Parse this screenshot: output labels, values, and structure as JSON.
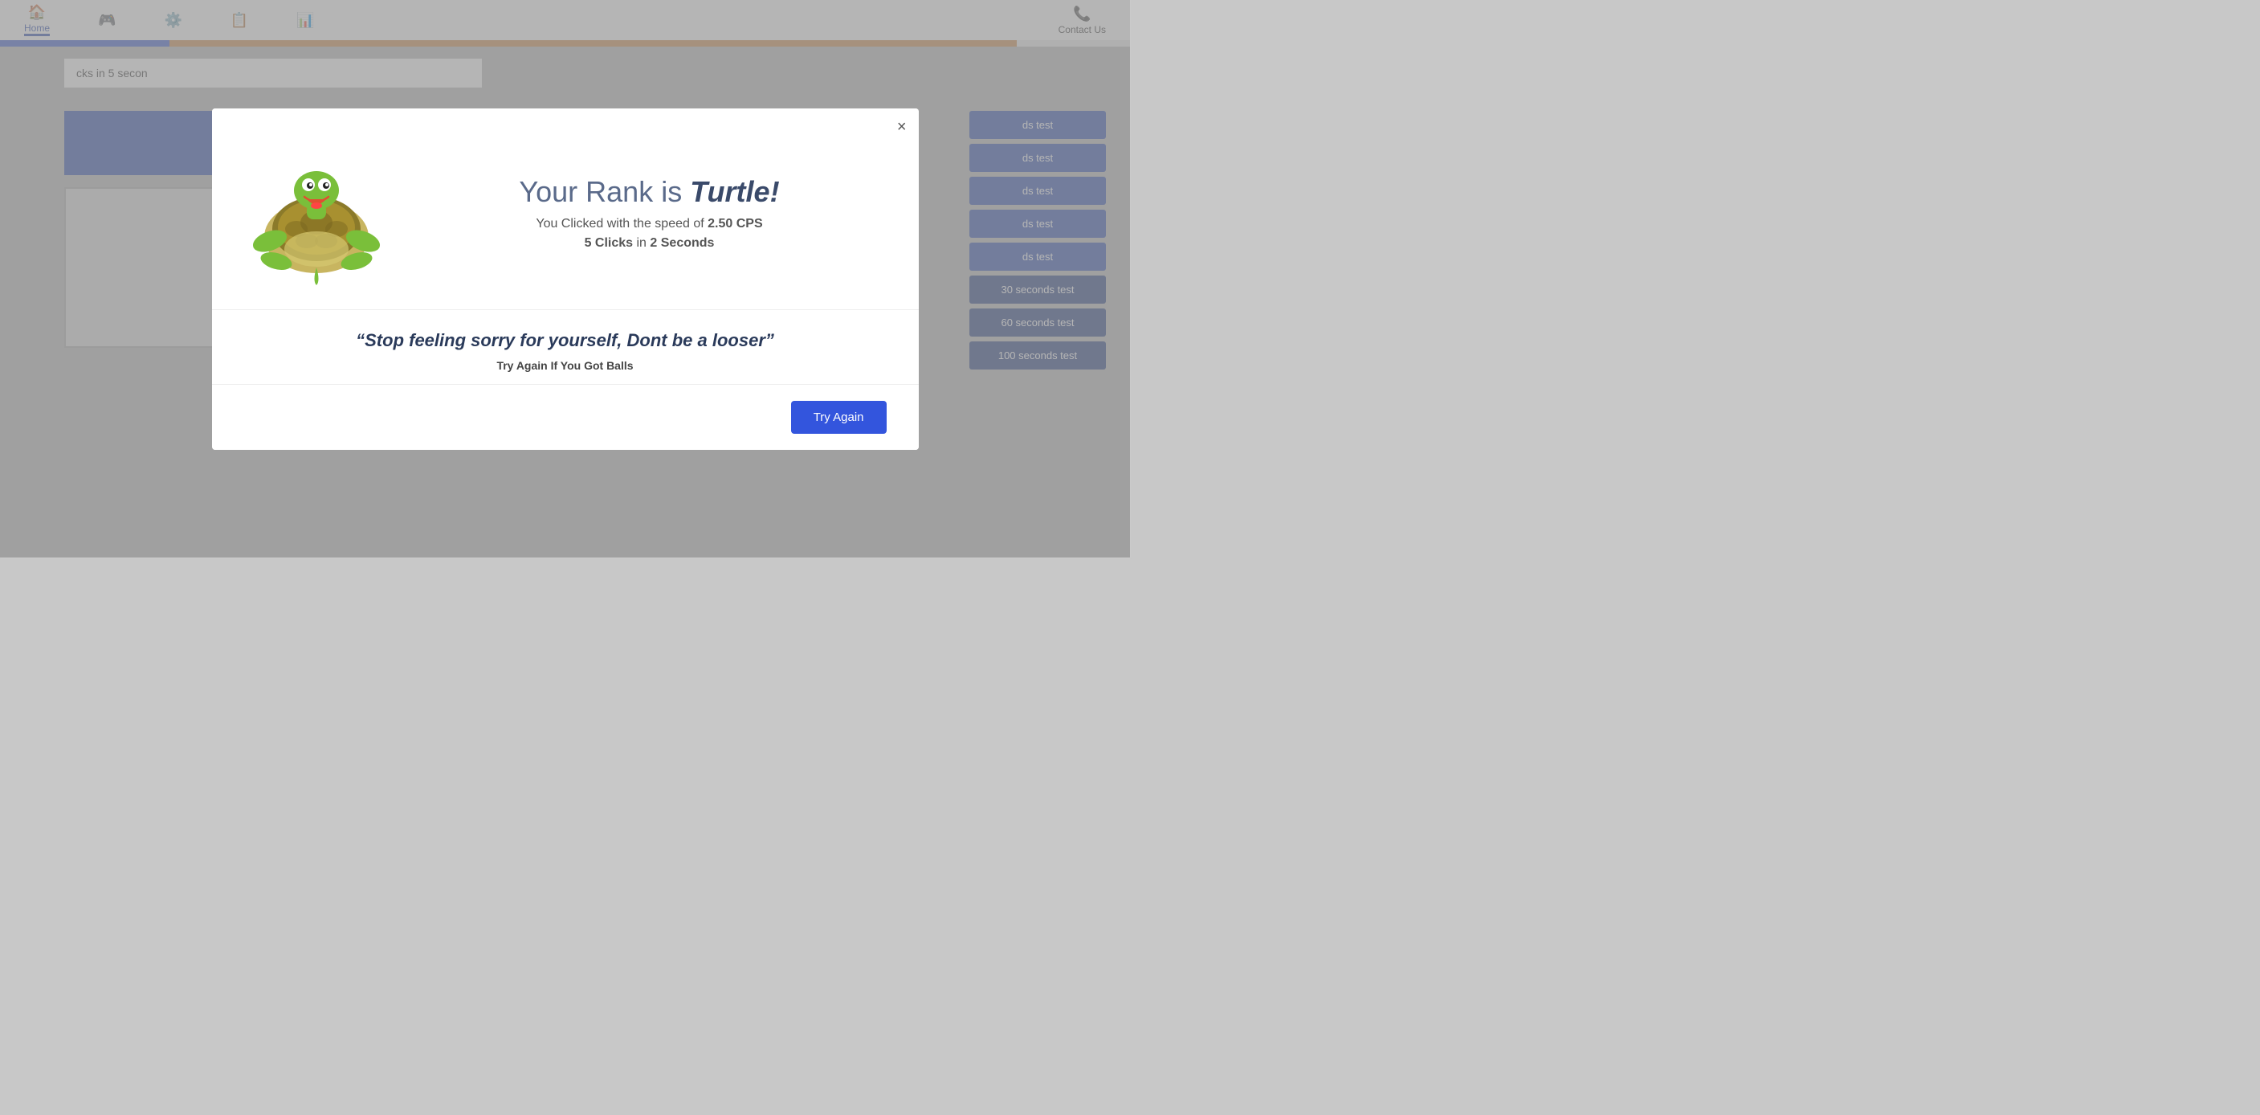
{
  "header": {
    "home_label": "Home",
    "contact_label": "Contact Us",
    "nav_items": [
      {
        "icon": "⌂",
        "label": ""
      },
      {
        "icon": "⊕",
        "label": ""
      },
      {
        "icon": "⚙",
        "label": ""
      },
      {
        "icon": "📋",
        "label": ""
      },
      {
        "icon": "📊",
        "label": ""
      }
    ]
  },
  "background": {
    "partial_text": "cks in 5 secon"
  },
  "sidebar": {
    "buttons": [
      {
        "label": "ds test",
        "style": "normal"
      },
      {
        "label": "ds test",
        "style": "normal"
      },
      {
        "label": "ds test",
        "style": "normal"
      },
      {
        "label": "ds test",
        "style": "normal"
      },
      {
        "label": "ds test",
        "style": "normal"
      },
      {
        "label": "30 seconds test",
        "style": "darker"
      },
      {
        "label": "60 seconds test",
        "style": "darker"
      },
      {
        "label": "100 seconds test",
        "style": "darker"
      }
    ]
  },
  "modal": {
    "close_label": "×",
    "rank_prefix": "Your Rank is",
    "rank_name": "Turtle!",
    "speed_text": "You Clicked with the speed of",
    "speed_value": "2.50 CPS",
    "clicks_count": "5 Clicks",
    "clicks_in": "in",
    "clicks_time": "2 Seconds",
    "quote": "“Stop feeling sorry for yourself, Dont be a looser”",
    "sub_quote": "Try Again If You Got Balls",
    "try_again_label": "Try Again"
  }
}
